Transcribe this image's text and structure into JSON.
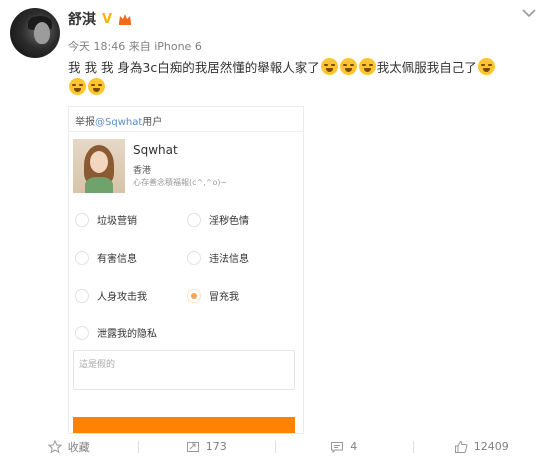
{
  "post": {
    "author": "舒淇",
    "verified_badge": "V",
    "meta": "今天 18:46 来自 iPhone 6",
    "text_line1": "我 我 我 身為3c白痴的我居然懂的舉報人家了",
    "text_line1_tail": "我太佩服我自己了",
    "emoji_count_line1": 4,
    "emoji_count_line2": 2
  },
  "report_card": {
    "title_prefix": "举报",
    "title_link": "@Sqwhat",
    "title_suffix": "用户",
    "user_name": "Sqwhat",
    "user_location": "香港",
    "user_signature": "心存善念積福報(c^,^o)~",
    "options": [
      {
        "label": "垃圾营销",
        "checked": false
      },
      {
        "label": "淫秽色情",
        "checked": false
      },
      {
        "label": "有害信息",
        "checked": false
      },
      {
        "label": "违法信息",
        "checked": false
      },
      {
        "label": "人身攻击我",
        "checked": false
      },
      {
        "label": "冒充我",
        "checked": true
      },
      {
        "label": "泄露我的隐私",
        "checked": false
      }
    ],
    "textarea_value": "這是假的"
  },
  "footer": {
    "favorite_label": "收藏",
    "repost_count": "173",
    "comment_count": "4",
    "like_count": "12409"
  },
  "colors": {
    "accent_orange": "#ff8200",
    "link_blue": "#5a8ec7",
    "verified_gold": "#f7b500"
  }
}
